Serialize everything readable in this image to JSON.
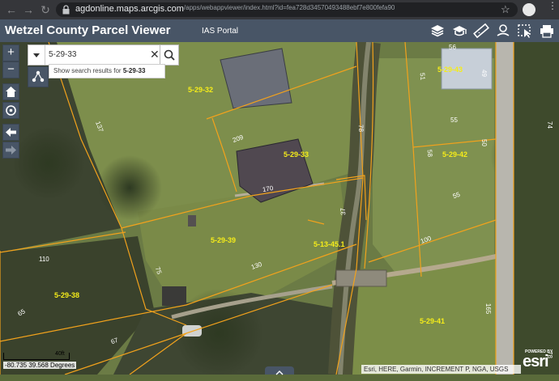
{
  "browser": {
    "url_host": "agdonline.maps.arcgis.com",
    "url_path": "/apps/webappviewer/index.html?id=fea728d34570493488ebf7e800fefa90"
  },
  "header": {
    "title": "Wetzel County Parcel Viewer",
    "subtitle": "IAS Portal",
    "icons": [
      "layers-icon",
      "basemap-gallery-icon",
      "measure-icon",
      "my-location-icon",
      "select-icon",
      "print-icon"
    ]
  },
  "search": {
    "value": "5-29-33",
    "suggestion_prefix": "Show search results for ",
    "suggestion_term": "5-29-33"
  },
  "map_controls": {
    "zoom_in": "+",
    "zoom_out": "−"
  },
  "parcels": [
    {
      "id": "5-29-32"
    },
    {
      "id": "5-29-33"
    },
    {
      "id": "5-29-43"
    },
    {
      "id": "5-29-42"
    },
    {
      "id": "5-29-39"
    },
    {
      "id": "5-13-45.1"
    },
    {
      "id": "5-29-38"
    },
    {
      "id": "5-29-41"
    }
  ],
  "dimensions": [
    "137",
    "209",
    "170",
    "78",
    "37",
    "51",
    "56",
    "49",
    "55",
    "50",
    "58",
    "55",
    "74",
    "100",
    "130",
    "110",
    "75",
    "65",
    "67",
    "165",
    "78"
  ],
  "status": {
    "coordinates": "-80.735 39.568 Degrees",
    "scale_label": "40ft",
    "attribution": "Esri, HERE, Garmin, INCREMENT P, NGA, USGS",
    "powered_by": "POWERED BY",
    "esri": "esri"
  }
}
